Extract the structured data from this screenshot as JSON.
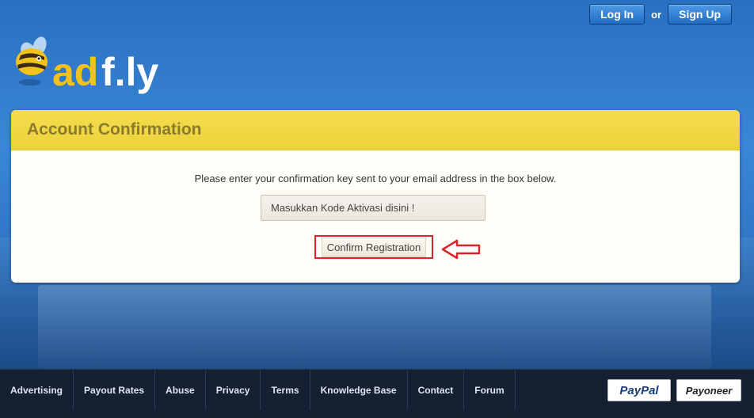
{
  "header": {
    "login_label": "Log In",
    "or_label": "or",
    "signup_label": "Sign Up",
    "logo_text": "adf.ly"
  },
  "card": {
    "title": "Account Confirmation",
    "instructions": "Please enter your confirmation key sent to your email address in the box below.",
    "key_input_value": "Masukkan Kode Aktivasi disini !",
    "confirm_label": "Confirm Registration"
  },
  "footer": {
    "nav": [
      "Advertising",
      "Payout Rates",
      "Abuse",
      "Privacy",
      "Terms",
      "Knowledge Base",
      "Contact",
      "Forum"
    ],
    "payment_badges": [
      "PayPal",
      "Payoneer"
    ]
  },
  "colors": {
    "header_blue": "#2f76c4",
    "card_header_yellow": "#ecd33a",
    "highlight_red": "#d8262a",
    "footer_bg": "#152033"
  }
}
